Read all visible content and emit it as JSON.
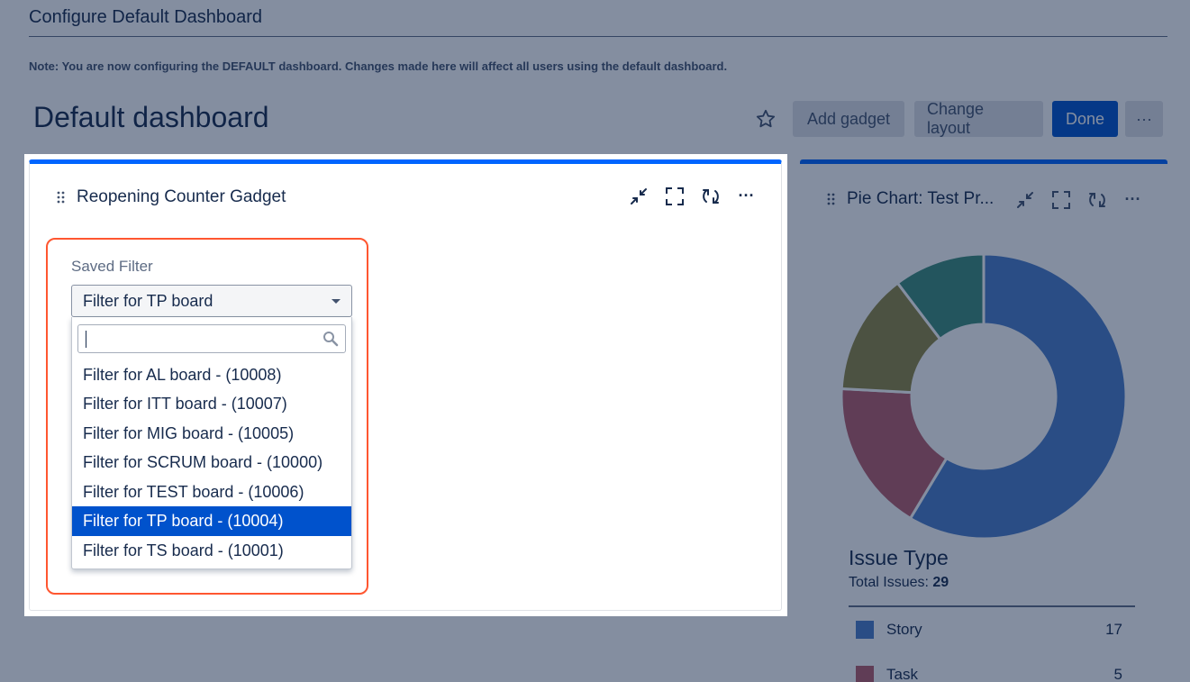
{
  "page": {
    "config_title": "Configure Default Dashboard",
    "note": "Note: You are now configuring the DEFAULT dashboard. Changes made here will affect all users using the default dashboard.",
    "dashboard_title": "Default dashboard"
  },
  "toolbar": {
    "star_icon": "star-icon",
    "add_gadget": "Add gadget",
    "change_layout": "Change layout",
    "done": "Done",
    "more": "···"
  },
  "gadget": {
    "title": "Reopening Counter Gadget",
    "icons": [
      "drag-handle-icon",
      "minimize-icon",
      "maximize-icon",
      "refresh-icon",
      "more-icon"
    ],
    "more": "···",
    "field_label": "Saved Filter",
    "selected_value": "Filter for TP board",
    "search_value": "",
    "options": [
      "Filter for AL board - (10008)",
      "Filter for ITT board - (10007)",
      "Filter for MIG board - (10005)",
      "Filter for SCRUM board - (10000)",
      "Filter for TEST board - (10006)",
      "Filter for TP board - (10004)",
      "Filter for TS board - (10001)"
    ],
    "selected_index": 5
  },
  "pie_gadget": {
    "title": "Pie Chart: Test Pr...",
    "more": "···",
    "issue_type": "Issue Type",
    "total_label": "Total Issues:",
    "total_value": "29",
    "legend": [
      {
        "name": "Story",
        "count": "17",
        "color": "#4a7cc8"
      },
      {
        "name": "Task",
        "count": "5",
        "color": "#b65c6b"
      }
    ],
    "slices": [
      {
        "value": 17,
        "color": "#4a7cc8"
      },
      {
        "value": 5,
        "color": "#b65c6b"
      },
      {
        "value": 4,
        "color": "#8f8742"
      },
      {
        "value": 3,
        "color": "#3d8c7a"
      }
    ]
  },
  "colors": {
    "primary": "#0052cc",
    "highlight": "#ff5630",
    "gadget_accent": "#0065ff"
  }
}
